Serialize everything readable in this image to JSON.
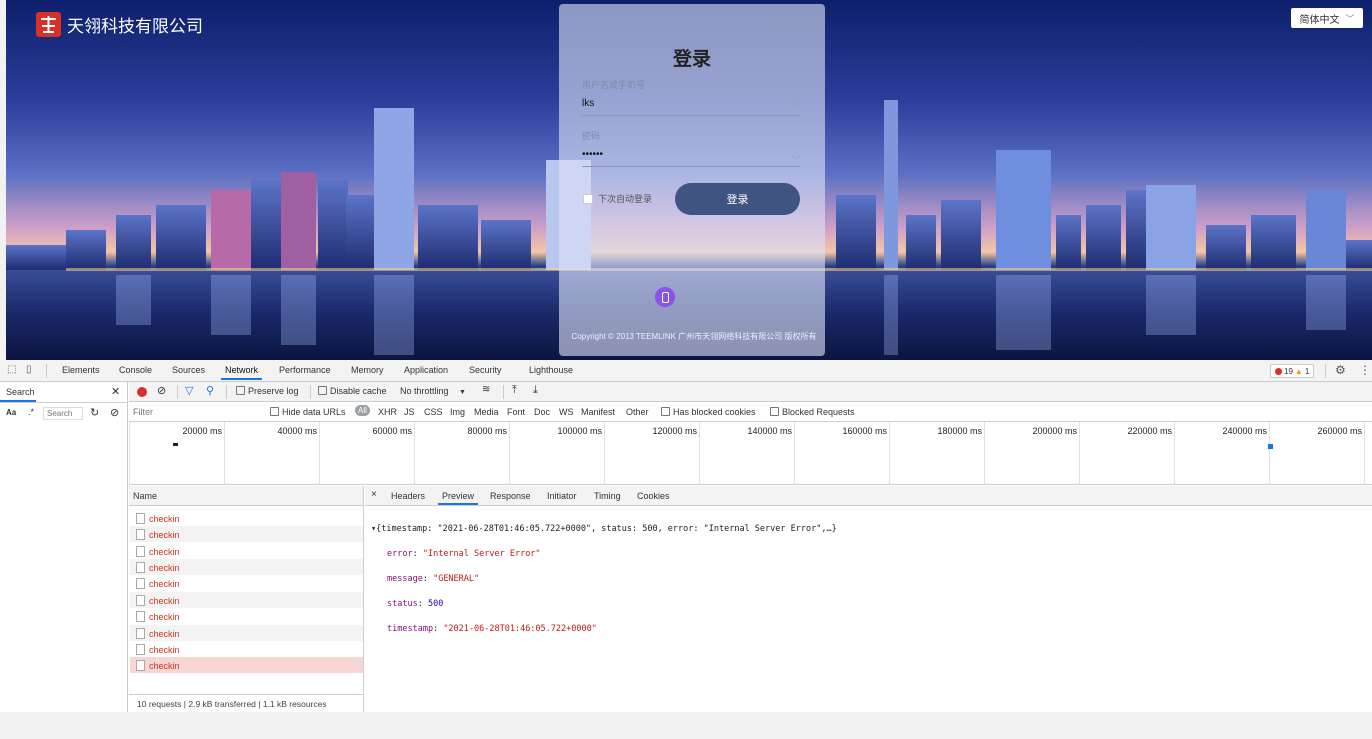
{
  "brand": {
    "name": "天翎科技有限公司"
  },
  "language": {
    "selected": "简体中文"
  },
  "login": {
    "title": "登录",
    "username_label": "用户名或手机号",
    "username_value": "lks",
    "password_label": "密码",
    "password_value": "••••••",
    "remember_label": "下次自动登录",
    "login_button": "登录",
    "copyright": "Copyright © 2013 TEEMLINK 广州市天翎网络科技有限公司 版权所有"
  },
  "devtools": {
    "tabs": [
      "Elements",
      "Console",
      "Sources",
      "Network",
      "Performance",
      "Memory",
      "Application",
      "Security",
      "Lighthouse"
    ],
    "active_tab": "Network",
    "errors": "19",
    "warnings": "1",
    "search_pane": {
      "title": "Search",
      "input_placeholder": "Search",
      "aa": "Aa",
      "regex": ".*"
    },
    "toolbar": {
      "preserve_log": "Preserve log",
      "disable_cache": "Disable cache",
      "throttling": "No throttling"
    },
    "filter": {
      "placeholder": "Filter",
      "hide_data_urls": "Hide data URLs",
      "types": [
        "All",
        "XHR",
        "JS",
        "CSS",
        "Img",
        "Media",
        "Font",
        "Doc",
        "WS",
        "Manifest",
        "Other"
      ],
      "has_blocked_cookies": "Has blocked cookies",
      "blocked_requests": "Blocked Requests"
    },
    "timeline_ticks": [
      "20000 ms",
      "40000 ms",
      "60000 ms",
      "80000 ms",
      "100000 ms",
      "120000 ms",
      "140000 ms",
      "160000 ms",
      "180000 ms",
      "200000 ms",
      "220000 ms",
      "240000 ms",
      "260000 ms"
    ],
    "list": {
      "header": "Name",
      "rows": [
        "checkin",
        "checkin",
        "checkin",
        "checkin",
        "checkin",
        "checkin",
        "checkin",
        "checkin",
        "checkin",
        "checkin"
      ],
      "footer": "10 requests  |  2.9 kB transferred  |  1.1 kB resources"
    },
    "detail_tabs": [
      "Headers",
      "Preview",
      "Response",
      "Initiator",
      "Timing",
      "Cookies"
    ],
    "detail_active": "Preview",
    "preview": {
      "summary": "▾{timestamp: \"2021-06-28T01:46:05.722+0000\", status: 500, error: \"Internal Server Error\",…}",
      "error_key": "error",
      "error_val": "\"Internal Server Error\"",
      "message_key": "message",
      "message_val": "\"GENERAL\"",
      "status_key": "status",
      "status_val": "500",
      "timestamp_key": "timestamp",
      "timestamp_val": "\"2021-06-28T01:46:05.722+0000\""
    }
  }
}
